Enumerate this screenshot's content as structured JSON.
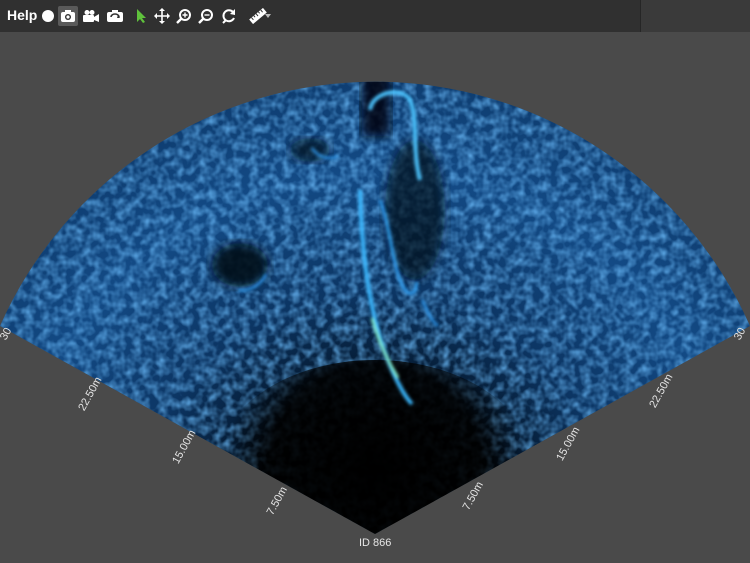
{
  "toolbar": {
    "help_label": "Help",
    "icons": [
      "record-icon",
      "camera-icon",
      "video-camera-icon",
      "switch-camera-icon",
      "pointer-icon",
      "move-icon",
      "zoom-in-icon",
      "zoom-out-icon",
      "reset-view-icon",
      "ruler-icon",
      "chevron-down-icon"
    ],
    "active_tool": "pointer-icon",
    "active_color": "#5fc23c"
  },
  "sonar": {
    "left_range_labels": [
      "7.50m",
      "15.00m",
      "22.50m",
      "30"
    ],
    "right_range_labels": [
      "7.50m",
      "15.00m",
      "22.50m",
      "30"
    ],
    "id_label": "ID 866",
    "colors": {
      "background": "#4a4a4a",
      "near": "#000000",
      "echo": "#1a7ad6",
      "strong_echo": "#3ad8ff",
      "highlight": "#4fd3a0"
    }
  }
}
